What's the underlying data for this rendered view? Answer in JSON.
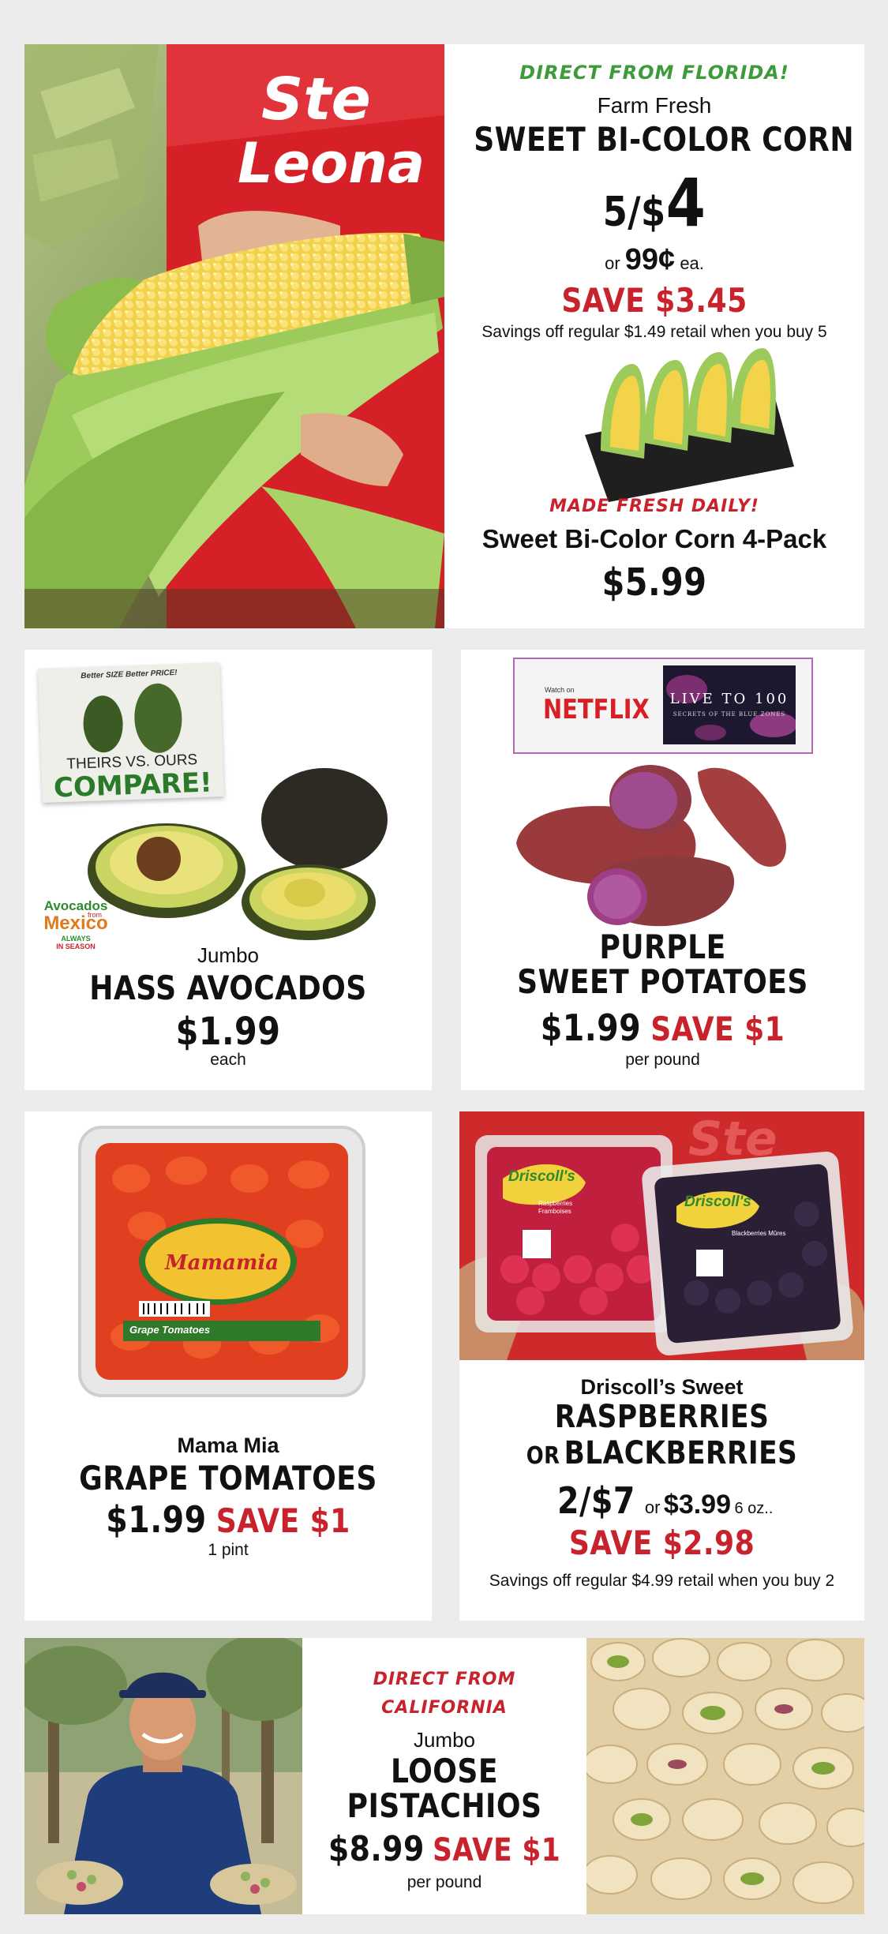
{
  "colors": {
    "page_bg": "#ececec",
    "card_bg": "#ffffff",
    "accent_red": "#c8232c",
    "accent_green": "#3e9b39",
    "text": "#111111"
  },
  "corn": {
    "tagline": "DIRECT FROM FLORIDA!",
    "pre": "Farm Fresh",
    "title": "SWEET BI-COLOR CORN",
    "deal_qty": "5/$",
    "deal_price": "4",
    "or_label": "or",
    "single_price": "99¢",
    "single_unit": "ea.",
    "save": "SAVE $3.45",
    "note": "Savings off regular $1.49 retail when you buy 5",
    "shirt_text": "Ste Leona",
    "pack_tagline": "MADE FRESH DAILY!",
    "pack_title": "Sweet Bi-Color Corn 4-Pack",
    "pack_price": "$5.99"
  },
  "avocado": {
    "compare_top": "Better SIZE Better PRICE!",
    "compare_mid": "THEIRS VS. OURS",
    "compare_big": "COMPARE!",
    "logo_top": "Avocados",
    "logo_from": "from",
    "logo_main": "Mexico",
    "logo_always": "ALWAYS",
    "logo_season": "IN SEASON",
    "pre": "Jumbo",
    "title": "HASS AVOCADOS",
    "price": "$1.99",
    "unit": "each"
  },
  "potato": {
    "watch_on": "Watch on",
    "netflix": "NETFLIX",
    "show_title": "LIVE TO 100",
    "show_sub": "SECRETS OF THE BLUE ZONES",
    "title1": "PURPLE",
    "title2": "SWEET POTATOES",
    "price": "$1.99",
    "save": "SAVE $1",
    "unit": "per pound"
  },
  "tomato": {
    "brand_label": "Mamamia",
    "pack_label": "Grape Tomatoes",
    "pre": "Mama Mia",
    "title": "GRAPE TOMATOES",
    "price": "$1.99",
    "save": "SAVE $1",
    "unit": "1 pint"
  },
  "berries": {
    "label1_brand": "Driscoll's",
    "label1_sub": "Raspberries Framboises",
    "label2_brand": "Driscoll's",
    "label2_sub": "Blackberries Mûres",
    "pre": "Driscoll’s Sweet",
    "title1": "RASPBERRIES",
    "title2_or": "OR",
    "title2": "BLACKBERRIES",
    "deal": "2/$7",
    "or_label": "or",
    "single_price": "$3.99",
    "size": "6 oz..",
    "save": "SAVE $2.98",
    "note": "Savings off regular $4.99 retail when you buy 2"
  },
  "pistachio": {
    "tagline1": "DIRECT FROM",
    "tagline2": "CALIFORNIA",
    "pre": "Jumbo",
    "title1": "LOOSE",
    "title2": "PISTACHIOS",
    "price": "$8.99",
    "save": "SAVE $1",
    "unit": "per pound"
  }
}
